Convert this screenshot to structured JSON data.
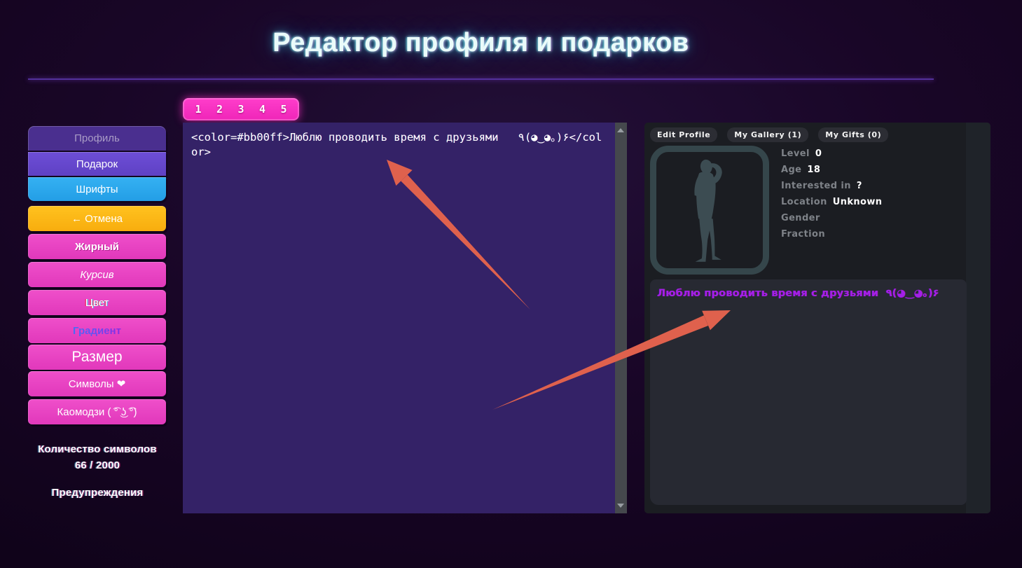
{
  "title": "Редактор профиля и подарков",
  "tabs": {
    "pages": [
      "1",
      "2",
      "3",
      "4",
      "5"
    ]
  },
  "sidebar": {
    "nav": {
      "profile": "Профиль",
      "gift": "Подарок",
      "fonts": "Шрифты"
    },
    "actions": {
      "cancel": "← Отмена",
      "bold": "Жирный",
      "italic": "Курсив",
      "color": "Цвет",
      "gradient": "Градиент",
      "size": "Размер",
      "symbols": "Символы ❤",
      "kaomoji": "Каомодзи ( ͡° ͜ʖ ͡°)"
    },
    "char_counter": {
      "label": "Количество символов",
      "value": "66 / 2000"
    },
    "warnings_label": "Предупреждения"
  },
  "editor": {
    "content": "<color=#bb00ff>Люблю проводить время с друзьями   ٩(◕‿◕｡)۶</color>"
  },
  "profile_panel": {
    "tabs": [
      "Edit Profile",
      "My Gallery (1)",
      "My Gifts (0)"
    ],
    "stats": [
      {
        "label": "Level",
        "value": "0"
      },
      {
        "label": "Age",
        "value": "18"
      },
      {
        "label": "Interested in",
        "value": "?"
      },
      {
        "label": "Location",
        "value": "Unknown"
      },
      {
        "label": "Gender",
        "value": ""
      },
      {
        "label": "Fraction",
        "value": ""
      }
    ],
    "bio_preview": "Люблю проводить время с друзьями  ٩(◕‿◕｡)۶"
  },
  "colors": {
    "accent_pink": "#e840c4",
    "accent_orange": "#fcb515",
    "accent_blue": "#2aa6ea",
    "accent_purple": "#6747cd",
    "editor_bg": "#342267",
    "bio_color": "#bb00ff",
    "arrow": "#df614d",
    "title_glow": "#46e1ff"
  }
}
